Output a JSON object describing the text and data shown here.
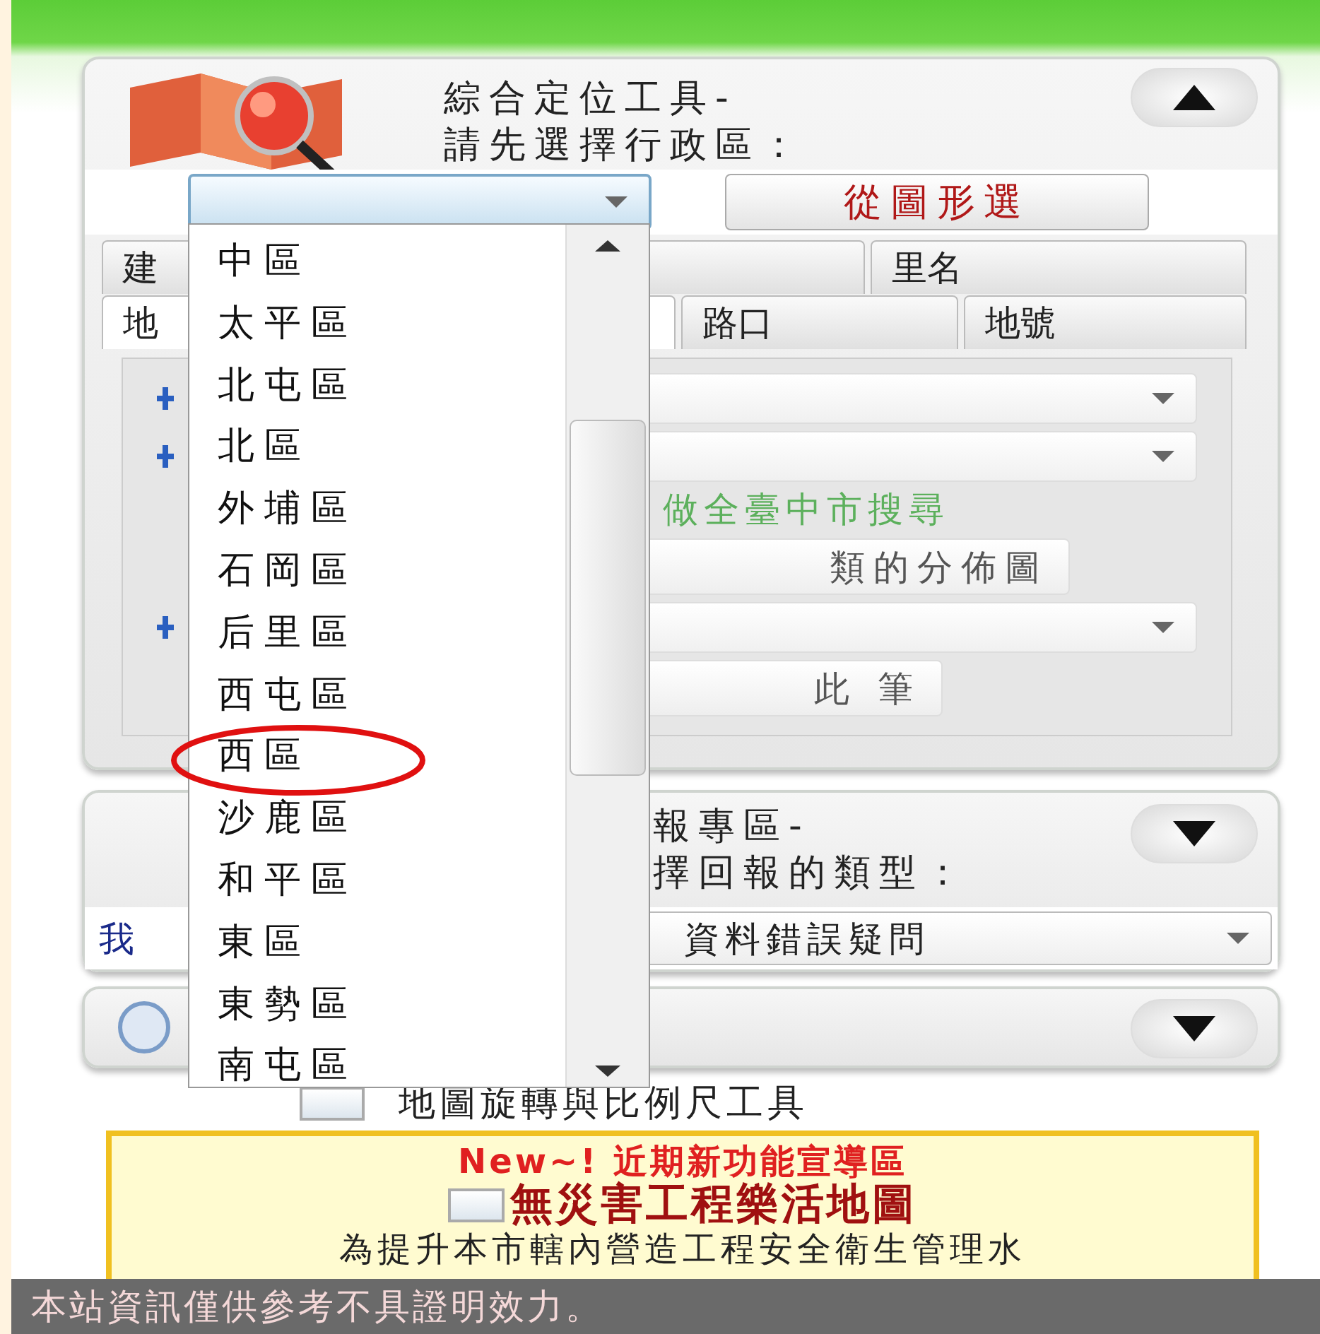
{
  "locator_panel": {
    "title_lines": [
      "綜合定位工具-",
      "請先選擇行政區："
    ],
    "expanded": true,
    "pick_button": "從圖形選",
    "tabs_row1": [
      {
        "label": "建",
        "selected": false
      },
      {
        "label": "里名",
        "selected": false
      }
    ],
    "tabs_row2": [
      {
        "label": "地",
        "selected": true
      },
      {
        "label": "路口",
        "selected": false
      },
      {
        "label": "地號",
        "selected": false
      }
    ],
    "hint": "做全臺中市搜尋",
    "buttons": [
      "類的分佈圖",
      "此 筆"
    ]
  },
  "district_dropdown": {
    "items": [
      "中區",
      "太平區",
      "北屯區",
      "北區",
      "外埔區",
      "石岡區",
      "后里區",
      "西屯區",
      "西區",
      "沙鹿區",
      "和平區",
      "東區",
      "東勢區",
      "南屯區"
    ]
  },
  "report_panel": {
    "title_lines": [
      "報專區-",
      "擇回報的類型："
    ],
    "expanded": false,
    "label": "我",
    "select_value": "資料錯誤疑問"
  },
  "third_panel": {
    "expanded": false
  },
  "options": [
    {
      "label": "地圖旋轉與比例尺工具",
      "checked": false
    }
  ],
  "news_box": {
    "heading": "New~! 近期新功能宣導區",
    "items": [
      {
        "label": "無災害工程樂活地圖",
        "checked": false
      }
    ],
    "text": "為提升本市轄內營造工程安全衛生管理水"
  },
  "status_bar": "本站資訊僅供參考不具證明效力。"
}
